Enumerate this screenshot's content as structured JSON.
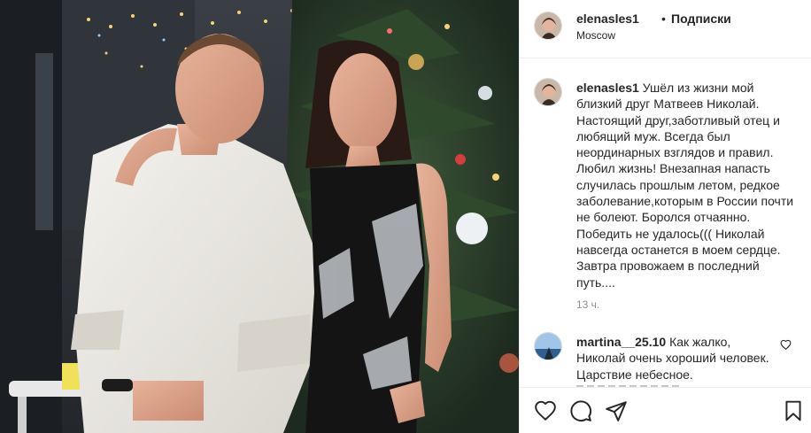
{
  "post": {
    "username": "elenasles1",
    "separator": "•",
    "follow_label": "Подписки",
    "location": "Moscow"
  },
  "caption": {
    "username": "elenasles1",
    "text": "Ушёл из жизни мой близкий друг Матвеев Николай. Настоящий друг,заботливый отец и любящий муж. Всегда был неординарных взглядов и правил. Любил жизнь! Внезапная напасть случилась прошлым летом, редкое заболевание,которым в России почти не болеют. Боролся отчаянно. Победить не удалось((( Николай навсегда останется в моем сердце. Завтра провожаем в последний путь....",
    "time": "13 ч."
  },
  "comments": [
    {
      "username": "martina__25.10",
      "text": "Как жалко, Николай очень хороший человек. Царствие небесное."
    }
  ],
  "icons": {
    "like": "heart-icon",
    "comment": "comment-bubble-icon",
    "share": "paper-plane-icon",
    "save": "bookmark-icon"
  },
  "colors": {
    "text": "#262626",
    "secondary": "#8e8e8e",
    "border": "#efefef"
  }
}
